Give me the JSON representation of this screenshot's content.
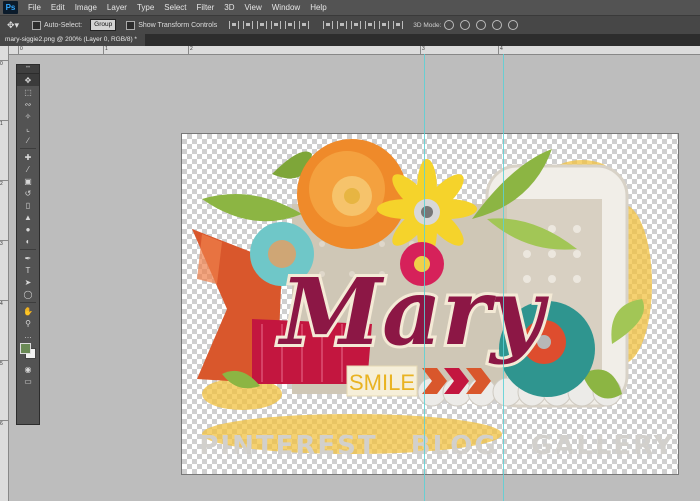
{
  "app": {
    "logo": "Ps"
  },
  "menu": [
    "File",
    "Edit",
    "Image",
    "Layer",
    "Type",
    "Select",
    "Filter",
    "3D",
    "View",
    "Window",
    "Help"
  ],
  "options": {
    "auto_select_label": "Auto-Select:",
    "auto_select_value": "Group",
    "transform_label": "Show Transform Controls",
    "mode_label": "3D Mode:"
  },
  "document": {
    "tab_title": "mary-siggie2.png @ 200% (Layer 0, RGB/8) *"
  },
  "ruler": {
    "top_ticks": [
      "0",
      "1",
      "2",
      "3",
      "4"
    ],
    "left_ticks": [
      "0",
      "1",
      "2",
      "3",
      "4",
      "5",
      "6"
    ]
  },
  "tools": [
    "move",
    "marquee",
    "lasso",
    "quick-select",
    "crop",
    "eyedropper",
    "healing",
    "brush",
    "stamp",
    "history-brush",
    "eraser",
    "gradient",
    "blur",
    "dodge",
    "pen",
    "type",
    "path-select",
    "shape",
    "hand",
    "zoom"
  ],
  "colors": {
    "foreground": "#6a8a55",
    "background": "#f2f2f2",
    "guide": "#5ad1d6"
  },
  "artwork": {
    "title_word": "Mary",
    "smile_label": "SMILE",
    "footer_text": "PINTEREST   BLOG   GALLERY"
  }
}
